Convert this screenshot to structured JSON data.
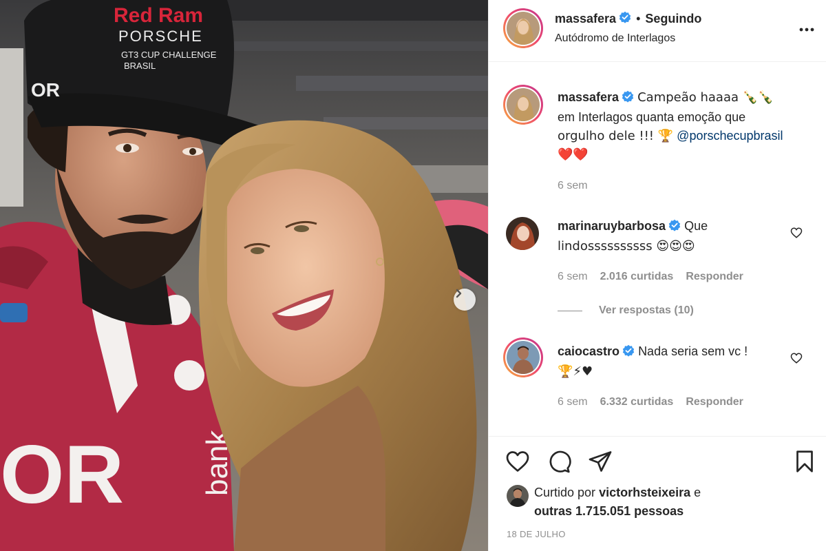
{
  "post": {
    "author": "massafera",
    "follow_status": "Seguindo",
    "location": "Autódromo de Interlagos",
    "caption_line1": "Campeão haaaa 🍾🍾",
    "caption_line2": "em Interlagos quanta emoção que",
    "caption_line3_pre": "orgulho dele !!! 🏆",
    "caption_mention": "@porschecupbrasil",
    "caption_line4": "❤️❤️",
    "caption_time": "6 sem",
    "liked_by_prefix": "Curtido por",
    "liked_by_user": "victorhsteixeira",
    "liked_by_suffix": "e",
    "liked_others": "outras 1.715.051 pessoas",
    "date": "18 DE JULHO"
  },
  "comments": [
    {
      "user": "marinaruybarbosa",
      "text_line1": "Que",
      "text_line2": "lindossssssssss 😍😍😍",
      "time": "6 sem",
      "likes": "2.016 curtidas",
      "reply": "Responder",
      "view_replies": "Ver respostas (10)"
    },
    {
      "user": "caiocastro",
      "text_line1": "Nada seria sem vc !",
      "text_line2": "🏆⚡♥",
      "time": "6 sem",
      "likes": "6.332 curtidas",
      "reply": "Responder"
    }
  ],
  "photo": {
    "cap_line1": "Red Ram",
    "cap_line2": "PORSCHE",
    "cap_line3": "GT3 CUP CHALLENGE",
    "cap_line4": "BRASIL",
    "cap_logo": "OR",
    "jacket_logo": "OR",
    "jacket_text": "bank"
  },
  "icons": {
    "verified": "verified-badge-icon",
    "more": "more-options-icon",
    "like": "heart-icon",
    "comment": "comment-icon",
    "share": "share-icon",
    "save": "bookmark-icon",
    "next": "chevron-right-icon"
  },
  "colors": {
    "verified_blue": "#3897f0",
    "mention_blue": "#00376b",
    "secondary_text": "#8e8e8e",
    "primary_text": "#262626",
    "jacket_red": "#b22a45"
  }
}
